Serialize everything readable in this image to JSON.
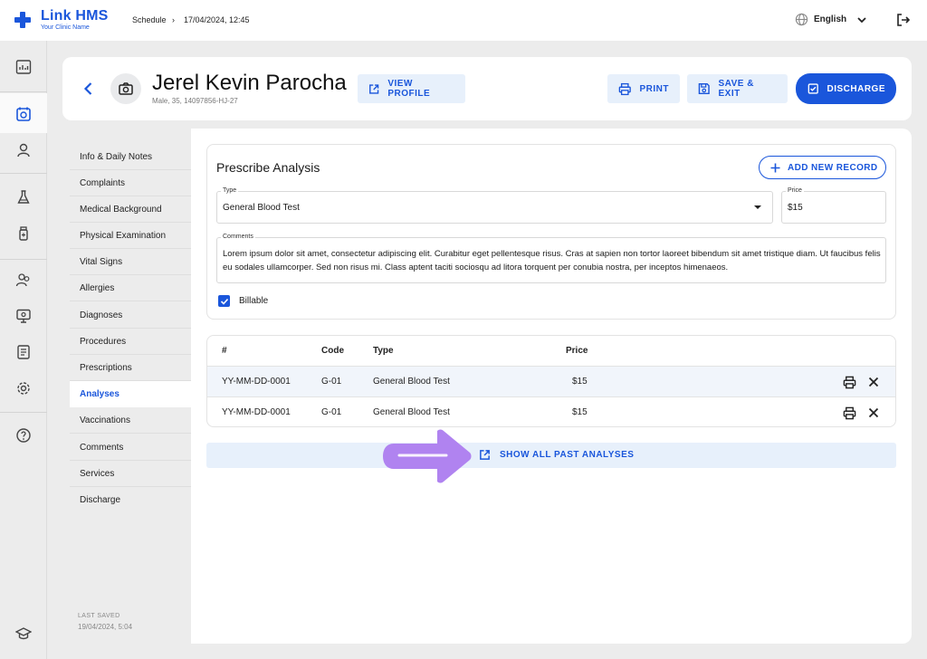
{
  "brand": {
    "name": "Link HMS",
    "tagline": "Your Clinic Name",
    "accent": "#1a56db"
  },
  "breadcrumb": {
    "section": "Schedule",
    "separator": "›",
    "current": "17/04/2024, 12:45"
  },
  "language": {
    "label": "English"
  },
  "rail_icons": [
    "dashboard-icon",
    "calendar-icon",
    "user-icon",
    "lab-flask-icon",
    "medicine-bottle-icon",
    "patients-icon",
    "monitor-icon",
    "report-icon",
    "settings-icon",
    "help-icon",
    "graduation-cap-icon"
  ],
  "patient": {
    "name": "Jerel Kevin Parocha",
    "meta": "Male, 35, 14097856-HJ-27"
  },
  "header_buttons": {
    "view_profile": "VIEW PROFILE",
    "print": "PRINT",
    "save_exit": "SAVE & EXIT",
    "discharge": "DISCHARGE"
  },
  "sidebar": {
    "items": [
      "Info & Daily Notes",
      "Complaints",
      "Medical Background",
      "Physical Examination",
      "Vital Signs",
      "Allergies",
      "Diagnoses",
      "Procedures",
      "Prescriptions",
      "Analyses",
      "Vaccinations",
      "Comments",
      "Services",
      "Discharge"
    ],
    "active": "Analyses",
    "last_saved_label": "LAST SAVED",
    "last_saved_value": "19/04/2024, 5:04"
  },
  "form": {
    "title": "Prescribe Analysis",
    "add_button": "ADD NEW RECORD",
    "type_label": "Type",
    "type_value": "General Blood Test",
    "price_label": "Price",
    "price_value": "$15",
    "comments_label": "Comments",
    "comments_value": "Lorem ipsum dolor sit amet, consectetur adipiscing elit. Curabitur eget pellentesque risus. Cras at sapien non tortor laoreet bibendum sit amet tristique diam. Ut faucibus felis eu sodales ullamcorper. Sed non risus mi. Class aptent taciti sociosqu ad litora torquent per conubia nostra, per inceptos himenaeos.",
    "billable_label": "Billable",
    "billable_checked": true
  },
  "table": {
    "headers": {
      "num": "#",
      "code": "Code",
      "type": "Type",
      "price": "Price"
    },
    "rows": [
      {
        "num": "YY-MM-DD-0001",
        "code": "G-01",
        "type": "General Blood Test",
        "price": "$15"
      },
      {
        "num": "YY-MM-DD-0001",
        "code": "G-01",
        "type": "General Blood Test",
        "price": "$15"
      }
    ]
  },
  "show_all": {
    "label": "SHOW ALL PAST ANALYSES"
  },
  "colors": {
    "arrow": "#b083f0",
    "light_button_bg": "#e7f0fb",
    "row_highlight": "#f1f5fb"
  }
}
